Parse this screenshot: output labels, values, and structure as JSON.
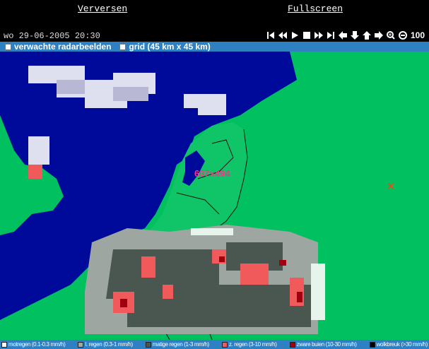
{
  "header": {
    "refresh_label": "Verversen",
    "fullscreen_label": "Fullscreen"
  },
  "datetime": "wo 29-06-2005 20:30",
  "controls": [
    {
      "icon": "skip-first-icon"
    },
    {
      "icon": "rewind-icon"
    },
    {
      "icon": "play-icon"
    },
    {
      "icon": "stop-icon"
    },
    {
      "icon": "fast-forward-icon"
    },
    {
      "icon": "skip-last-icon"
    },
    {
      "icon": "arrow-left-icon"
    },
    {
      "icon": "arrow-down-icon"
    },
    {
      "icon": "arrow-up-icon"
    },
    {
      "icon": "arrow-right-icon"
    },
    {
      "icon": "zoom-in-icon"
    },
    {
      "icon": "zoom-out-icon"
    }
  ],
  "zoom_level": "100",
  "options": {
    "forecast_label": "verwachte radarbeelden",
    "grid_label": "grid (45 km x 45 km)"
  },
  "map": {
    "size_label": "607x494",
    "marker": "×"
  },
  "legend": [
    {
      "label": "motregen (0.1-0.3 mm/h)",
      "color": "#ffffff"
    },
    {
      "label": "l. regen (0.3-1 mm/h)",
      "color": "#a0a8a4"
    },
    {
      "label": "matige regen (1-3 mm/h)",
      "color": "#4a5650"
    },
    {
      "label": "z. regen (3-10 mm/h)",
      "color": "#f05a5a"
    },
    {
      "label": "zware buien (10-30 mm/h)",
      "color": "#a00010"
    },
    {
      "label": "wolkbreuk (>30 mm/h)",
      "color": "#000000"
    }
  ],
  "colors": {
    "sea": "#000a9a",
    "land": "#00c060",
    "bar": "#2e80c2"
  }
}
